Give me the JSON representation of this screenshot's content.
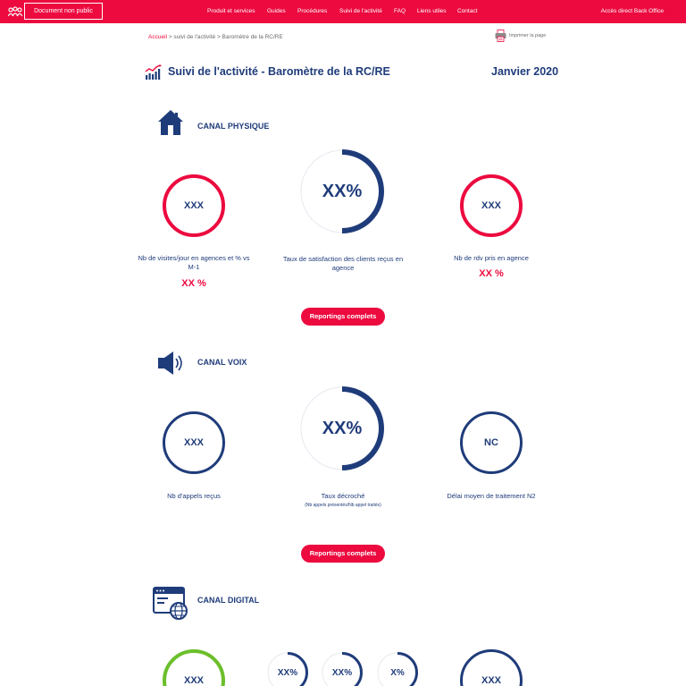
{
  "topbar": {
    "doc_label": "Document non public",
    "nav": [
      "Produit et services",
      "Guides",
      "Procédures",
      "Suivi de l'activité",
      "FAQ",
      "Liens utiles",
      "Contact"
    ],
    "backoffice": "Accès direct Back Office"
  },
  "breadcrumb": {
    "home": "Accueil",
    "rest": " > suivi de l'activité > Baromètre de la RC/RE"
  },
  "print_label": "Imprimer la page",
  "page": {
    "title": "Suivi de l'activité - Baromètre de la RC/RE",
    "date": "Janvier 2020"
  },
  "sections": {
    "physique": {
      "title": "CANAL PHYSIQUE",
      "metric1": {
        "value": "XXX",
        "label": "Nb de visites/jour en agences et % vs M-1",
        "kpi": "XX %"
      },
      "metric2": {
        "value": "XX%",
        "label": "Taux de satisfaction des clients reçus en agence",
        "fill": 0.5
      },
      "metric3": {
        "value": "XXX",
        "label": "Nb de rdv pris en agence",
        "kpi": "XX %"
      },
      "button": "Reportings complets"
    },
    "voix": {
      "title": "CANAL VOIX",
      "metric1": {
        "value": "XXX",
        "label": "Nb d'appels reçus"
      },
      "metric2": {
        "value": "XX%",
        "label": "Taux décroché",
        "sublabel": "(Nb appels présentés/Nb appel traités)",
        "fill": 0.5
      },
      "metric3": {
        "value": "NC",
        "label": "Délai moyen de traitement N2"
      },
      "button": "Reportings complets"
    },
    "digital": {
      "title": "CANAL DIGITAL",
      "metric1": {
        "value": "XXX"
      },
      "metric2": {
        "value": "XX%",
        "fill": 0.5
      },
      "metric3": {
        "value": "XX%",
        "fill": 0.5
      },
      "metric4": {
        "value": "X%",
        "fill": 0.5
      },
      "metric5": {
        "value": "XXX"
      }
    }
  },
  "colors": {
    "brand_red": "#ec0a3f",
    "navy": "#1f3c7a",
    "green": "#6bbf2b"
  }
}
